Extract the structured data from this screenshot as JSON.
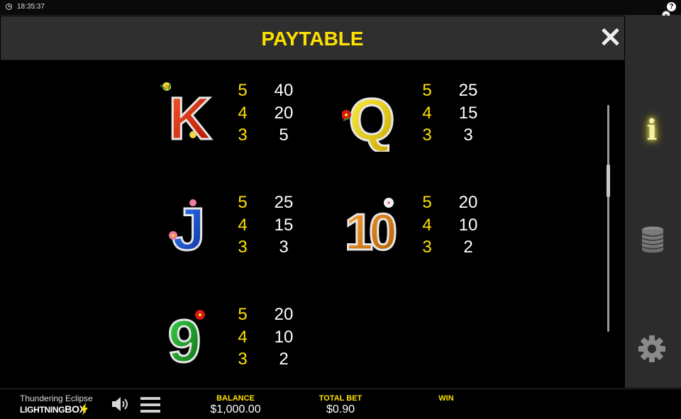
{
  "status": {
    "time": "18:35:37",
    "help_label": "?",
    "close_label": "×"
  },
  "header": {
    "title": "PAYTABLE"
  },
  "colors": {
    "accent": "#ffe100",
    "panel": "#2c2c2c",
    "header": "#2f2f2f"
  },
  "symbols": [
    {
      "name": "K",
      "pays": [
        {
          "count": "5",
          "value": "40"
        },
        {
          "count": "4",
          "value": "20"
        },
        {
          "count": "3",
          "value": "5"
        }
      ]
    },
    {
      "name": "Q",
      "pays": [
        {
          "count": "5",
          "value": "25"
        },
        {
          "count": "4",
          "value": "15"
        },
        {
          "count": "3",
          "value": "3"
        }
      ]
    },
    {
      "name": "J",
      "pays": [
        {
          "count": "5",
          "value": "25"
        },
        {
          "count": "4",
          "value": "15"
        },
        {
          "count": "3",
          "value": "3"
        }
      ]
    },
    {
      "name": "10",
      "pays": [
        {
          "count": "5",
          "value": "20"
        },
        {
          "count": "4",
          "value": "10"
        },
        {
          "count": "3",
          "value": "2"
        }
      ]
    },
    {
      "name": "9",
      "pays": [
        {
          "count": "5",
          "value": "20"
        },
        {
          "count": "4",
          "value": "10"
        },
        {
          "count": "3",
          "value": "2"
        }
      ]
    }
  ],
  "sidepanel": {
    "info_label": "i",
    "icons": [
      "info-icon",
      "coins-icon",
      "gear-icon"
    ]
  },
  "footer": {
    "game_name": "Thundering Eclipse",
    "brand_part1": "LIGHTNING",
    "brand_part2": "BOX",
    "balance_label": "BALANCE",
    "balance_value": "$1,000.00",
    "total_bet_label": "TOTAL BET",
    "total_bet_value": "$0.90",
    "win_label": "WIN"
  }
}
